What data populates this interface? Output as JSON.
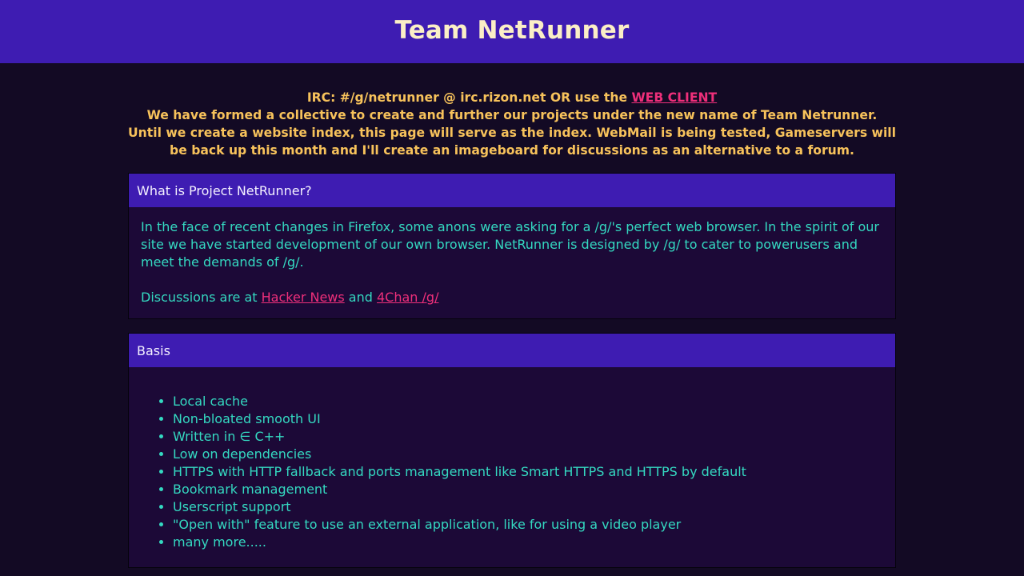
{
  "header": {
    "title": "Team NetRunner"
  },
  "notice": {
    "irc_text": "IRC: #/g/netrunner @ irc.rizon.net OR use the ",
    "web_client_link": "WEB CLIENT",
    "message": "We have formed a collective to create and further our projects under the new name of Team Netrunner. Until we create a website index, this page will serve as the index. WebMail is being tested, Gameservers will be back up this month and I'll create an imageboard for discussions as an alternative to a forum."
  },
  "about": {
    "heading": "What is Project NetRunner?",
    "paragraph": "In the face of recent changes in Firefox, some anons were asking for a /g/'s perfect web browser. In the spirit of our site we have started development of our own browser. NetRunner is designed by /g/ to cater to powerusers and meet the demands of /g/.",
    "discussions_prefix": "Discussions are at ",
    "hacker_news_link": "Hacker News",
    "and_text": " and ",
    "fourchan_link": "4Chan /g/"
  },
  "basis": {
    "heading": "Basis",
    "items": [
      "Local cache",
      "Non-bloated smooth UI",
      "Written in ∈ C++",
      "Low on dependencies",
      "HTTPS with HTTP fallback and ports management like Smart HTTPS and HTTPS by default",
      "Bookmark management",
      "Userscript support",
      "\"Open with\" feature to use an external application, like for using a video player",
      "many more....."
    ]
  },
  "colors": {
    "header_bg": "#3e1cb2",
    "page_bg": "#130a24",
    "panel_bg": "#1c0937",
    "title_text": "#fbefc6",
    "notice_text": "#f7c25b",
    "body_text": "#34d9c1",
    "link": "#ee2f7a"
  }
}
